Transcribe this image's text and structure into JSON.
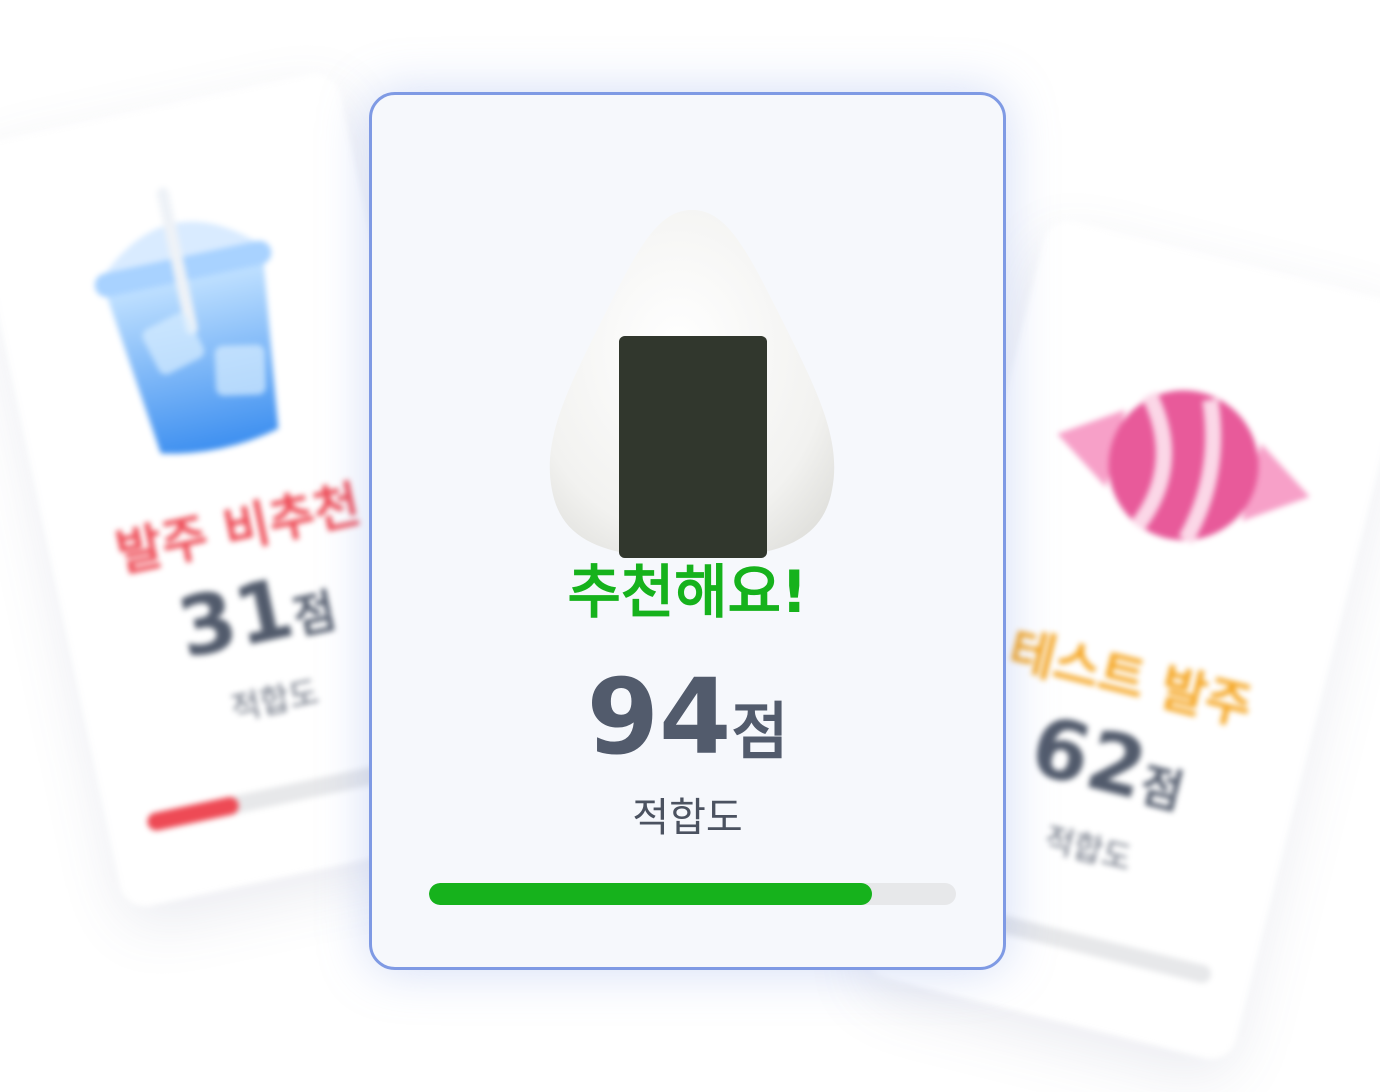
{
  "cards": {
    "left": {
      "label": "발주 비추천",
      "score": "31",
      "score_unit": "점",
      "sub": "적합도",
      "progress": 0.31,
      "accent": "#ee4a55",
      "icon": "iced-drink-icon"
    },
    "center": {
      "label": "추천해요!",
      "score": "94",
      "score_unit": "점",
      "sub": "적합도",
      "progress": 0.84,
      "accent": "#16b21c",
      "icon": "onigiri-icon"
    },
    "right": {
      "label": "테스트 발주",
      "score": "62",
      "score_unit": "점",
      "sub": "적합도",
      "progress": 0.1,
      "accent": "#f5a623",
      "icon": "candy-icon"
    }
  }
}
